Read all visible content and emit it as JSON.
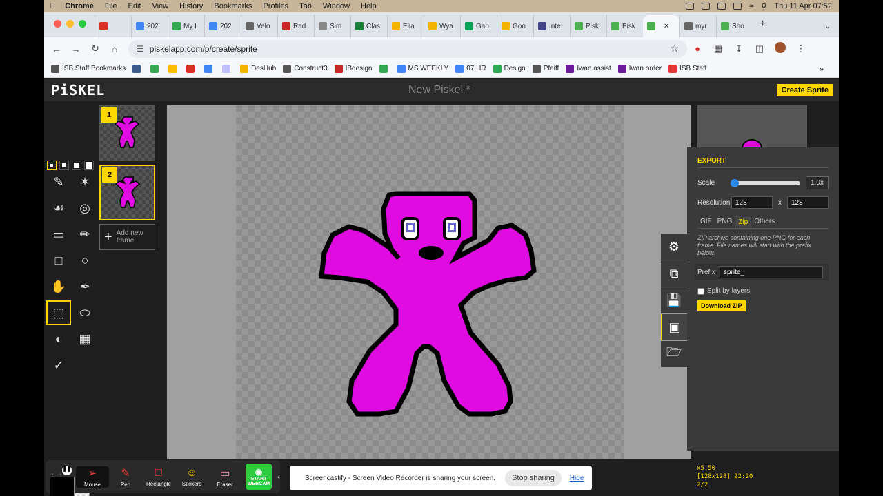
{
  "menubar": {
    "app_name": "Chrome",
    "items": [
      "File",
      "Edit",
      "View",
      "History",
      "Bookmarks",
      "Profiles",
      "Tab",
      "Window",
      "Help"
    ],
    "clock": "Thu 11 Apr  07:52"
  },
  "tabs": [
    {
      "label": "",
      "color": "#d93025"
    },
    {
      "label": "202",
      "color": "#4285f4"
    },
    {
      "label": "My I",
      "color": "#34a853"
    },
    {
      "label": "202",
      "color": "#4285f4"
    },
    {
      "label": "Velo",
      "color": "#666666"
    },
    {
      "label": "Rad",
      "color": "#c62828"
    },
    {
      "label": "Sim",
      "color": "#888888"
    },
    {
      "label": "Clas",
      "color": "#188038"
    },
    {
      "label": "Elia",
      "color": "#f4b400"
    },
    {
      "label": "Wya",
      "color": "#f4b400"
    },
    {
      "label": "Gan",
      "color": "#0f9d58"
    },
    {
      "label": "Goo",
      "color": "#f4b400"
    },
    {
      "label": "Inte",
      "color": "#444488"
    },
    {
      "label": "Pisk",
      "color": "#4caf50"
    },
    {
      "label": "Pisk",
      "color": "#4caf50"
    },
    {
      "label": "",
      "color": "#4caf50"
    },
    {
      "label": "myr",
      "color": "#666666"
    },
    {
      "label": "Sho",
      "color": "#4caf50"
    }
  ],
  "toolbar": {
    "url": "piskelapp.com/p/create/sprite"
  },
  "bookmarks": [
    {
      "label": "ISB Staff Bookmarks",
      "color": "#555555"
    },
    {
      "label": "",
      "color": "#3c5a8a"
    },
    {
      "label": "",
      "color": "#34a853"
    },
    {
      "label": "",
      "color": "#fbbc04"
    },
    {
      "label": "",
      "color": "#d93025"
    },
    {
      "label": "",
      "color": "#4285f4"
    },
    {
      "label": "",
      "color": "#c0c0ff"
    },
    {
      "label": "DesHub",
      "color": "#f4b400"
    },
    {
      "label": "Construct3",
      "color": "#555555"
    },
    {
      "label": "IBdesign",
      "color": "#c62828"
    },
    {
      "label": "",
      "color": "#34a853"
    },
    {
      "label": "MS WEEKLY",
      "color": "#4285f4"
    },
    {
      "label": "07 HR",
      "color": "#4285f4"
    },
    {
      "label": "Design",
      "color": "#34a853"
    },
    {
      "label": "Pfeiff",
      "color": "#555555"
    },
    {
      "label": "Iwan assist",
      "color": "#6a1b9a"
    },
    {
      "label": "Iwan order",
      "color": "#6a1b9a"
    },
    {
      "label": "ISB Staff",
      "color": "#e53935"
    }
  ],
  "piskel": {
    "logo": "PiSKEL",
    "title": "New Piskel *",
    "create_sprite": "Create Sprite",
    "frames": [
      {
        "number": "1"
      },
      {
        "number": "2"
      }
    ],
    "add_frame": "Add new frame",
    "primary_color": "#000000",
    "sprite_color": "#e00be0"
  },
  "export": {
    "heading": "EXPORT",
    "scale_label": "Scale",
    "scale_value": "1.0x",
    "resolution_label": "Resolution",
    "width": "128",
    "x": "x",
    "height": "128",
    "tabs": [
      "GIF",
      "PNG",
      "Zip",
      "Others"
    ],
    "selected_tab": "Zip",
    "description": "ZIP archive containing one PNG for each frame. File names will start with the prefix below.",
    "prefix_label": "Prefix",
    "prefix_value": "sprite_",
    "split_layers": "Split by layers",
    "download": "Download ZIP"
  },
  "status": {
    "zoom": "x5.50",
    "size_cursor": "[128x128] 22:20",
    "frame": "2/2"
  },
  "screencastify": {
    "tools": [
      "Mouse",
      "Pen",
      "Rectangle",
      "Stickers",
      "Eraser"
    ],
    "webcam": "START WEBCAM",
    "share_text": "Screencastify - Screen Video Recorder is sharing your screen.",
    "stop_sharing": "Stop sharing",
    "hide": "Hide"
  }
}
